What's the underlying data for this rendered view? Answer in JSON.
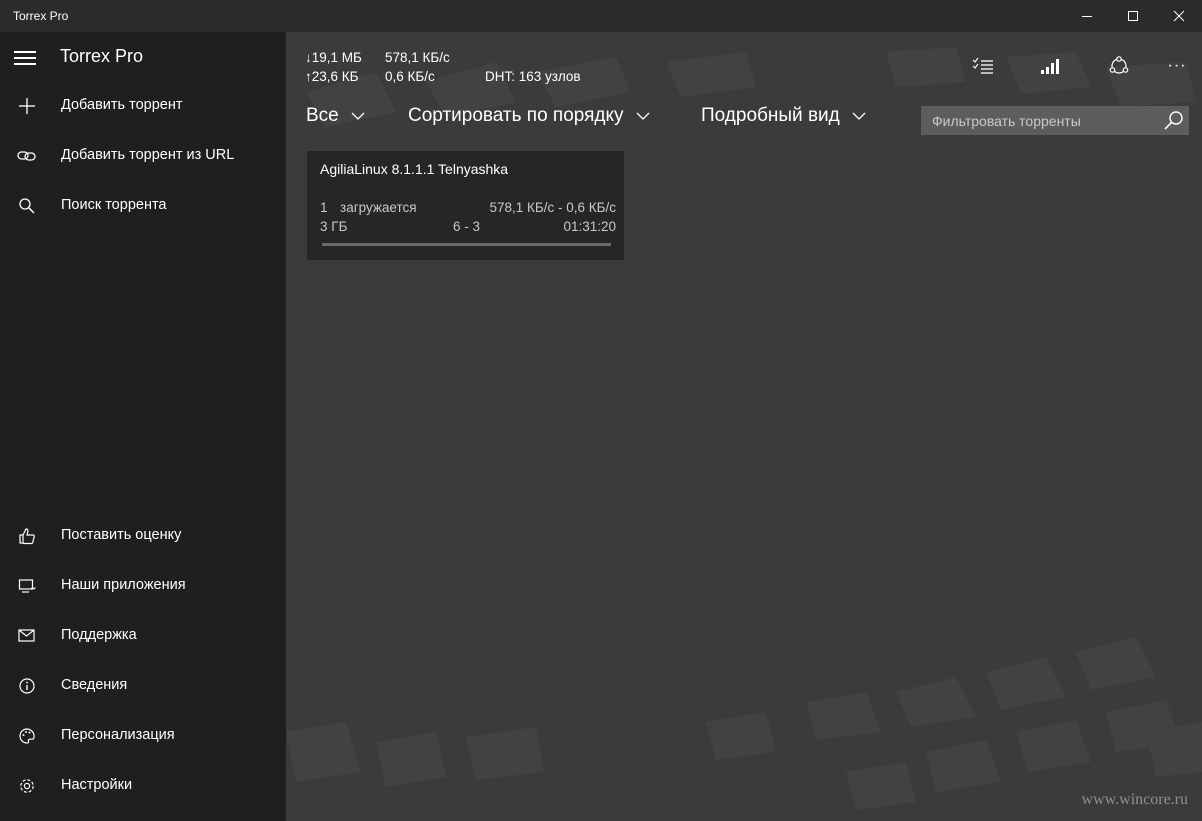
{
  "window": {
    "title": "Torrex Pro",
    "controls": {
      "minimize": "minimize-icon",
      "maximize": "maximize-icon",
      "close": "close-icon"
    }
  },
  "sidebar": {
    "app_name": "Torrex Pro",
    "top_items": [
      {
        "label": "Добавить торрент",
        "icon": "plus-icon"
      },
      {
        "label": "Добавить торрент из URL",
        "icon": "link-icon"
      },
      {
        "label": "Поиск торрента",
        "icon": "search-icon"
      }
    ],
    "bottom_items": [
      {
        "label": "Поставить оценку",
        "icon": "thumbs-up-icon"
      },
      {
        "label": "Наши приложения",
        "icon": "apps-icon"
      },
      {
        "label": "Поддержка",
        "icon": "mail-icon"
      },
      {
        "label": "Сведения",
        "icon": "info-icon"
      },
      {
        "label": "Персонализация",
        "icon": "palette-icon"
      },
      {
        "label": "Настройки",
        "icon": "gear-icon"
      }
    ]
  },
  "stats": {
    "downloaded": "↓19,1 МБ",
    "uploaded": "↑23,6 КБ",
    "down_speed": "578,1 КБ/с",
    "up_speed": "0,6 КБ/с",
    "dht": "DHT: 163 узлов"
  },
  "toolbar": {
    "icons": [
      "checklist-icon",
      "signal-icon",
      "share-icon",
      "more-icon"
    ],
    "more_label": "···"
  },
  "filters": {
    "category": "Все",
    "sort": "Сортировать по порядку",
    "view": "Подробный вид",
    "search_placeholder": "Фильтровать торренты"
  },
  "torrents": [
    {
      "name": "AgiliaLinux 8.1.1.1 Telnyashka",
      "index": "1",
      "status": "загружается",
      "speeds": "578,1 КБ/с - 0,6 КБ/с",
      "size": "3 ГБ",
      "peers": "6 - 3",
      "eta": "01:31:20",
      "progress": 0.0
    }
  ],
  "watermark": "www.wincore.ru",
  "colors": {
    "sidebar_bg": "#1f1f1f",
    "main_bg": "#3b3b3b",
    "titlebar_bg": "#2b2b2b",
    "card_bg": "#262626",
    "filter_bg": "#5d5d5d"
  }
}
